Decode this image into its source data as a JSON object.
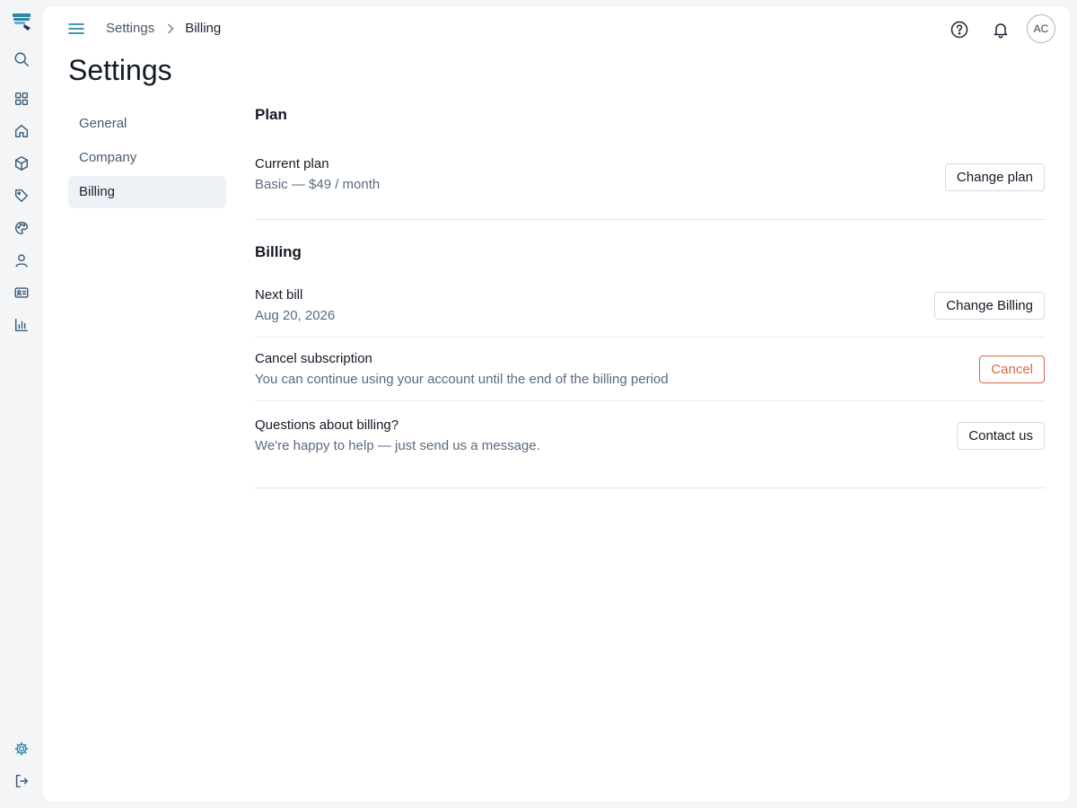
{
  "breadcrumb": {
    "parent": "Settings",
    "current": "Billing"
  },
  "header": {
    "avatar_initials": "AC"
  },
  "page": {
    "title": "Settings"
  },
  "subnav": {
    "items": [
      {
        "label": "General"
      },
      {
        "label": "Company"
      },
      {
        "label": "Billing"
      }
    ],
    "active": "Billing"
  },
  "plan_section": {
    "title": "Plan",
    "current_plan": {
      "label": "Current plan",
      "value": "Basic — $49 / month",
      "button": "Change plan"
    }
  },
  "billing_section": {
    "title": "Billing",
    "next_bill": {
      "label": "Next bill",
      "value": "Aug 20, 2026",
      "button": "Change Billing"
    },
    "cancel": {
      "label": "Cancel subscription",
      "value": "You can continue using your account until the end of the billing period",
      "button": "Cancel"
    },
    "questions": {
      "label": "Questions about billing?",
      "value": "We're happy to help — just send us a message.",
      "button": "Contact us"
    }
  },
  "icons": {
    "rail": [
      "app-logo-icon",
      "search-icon",
      "dashboard-icon",
      "home-icon",
      "box-icon",
      "tag-icon",
      "palette-icon",
      "user-icon",
      "id-card-icon",
      "bar-chart-icon",
      "gear-icon",
      "logout-icon"
    ],
    "header": [
      "menu-icon",
      "chevron-right-icon",
      "help-icon",
      "bell-icon"
    ]
  },
  "colors": {
    "accent": "#2f86a6",
    "danger": "#d9684a",
    "active_nav_bg": "#eef1f6"
  }
}
